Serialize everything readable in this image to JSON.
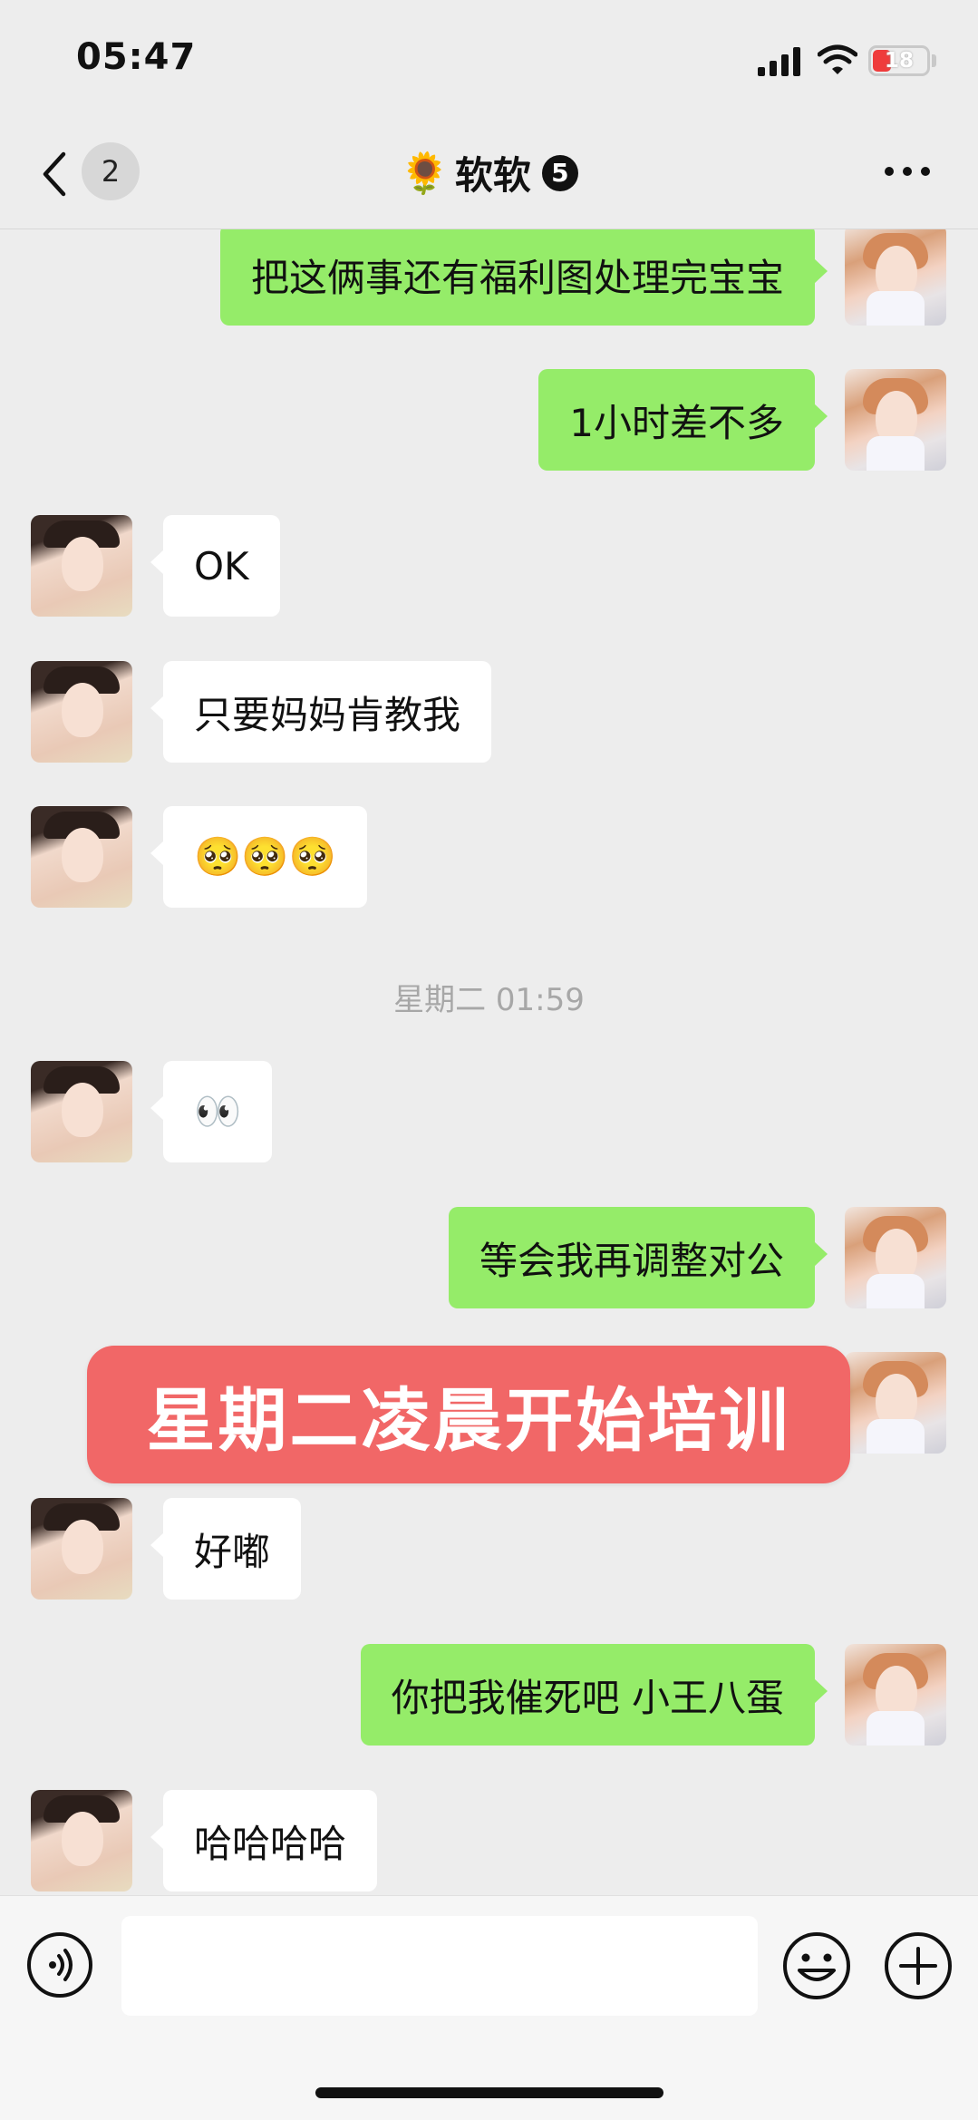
{
  "status_bar": {
    "time": "05:47",
    "battery": "18",
    "battery_color": "#ef3b3b"
  },
  "header": {
    "back_icon": "chevron-left-icon",
    "unread_count": "2",
    "title_emoji": "🌻",
    "title": "软软",
    "title_badge": "5",
    "more_icon": "ellipsis-icon"
  },
  "messages": [
    {
      "side": "out",
      "text": "把这俩事还有福利图处理完宝宝"
    },
    {
      "side": "out",
      "text": "1小时差不多"
    },
    {
      "side": "in",
      "text": "OK"
    },
    {
      "side": "in",
      "text": "只要妈妈肯教我"
    },
    {
      "side": "in",
      "text": "🥺🥺🥺"
    },
    {
      "type": "time",
      "text": "星期二 01:59"
    },
    {
      "side": "in",
      "text": "👀"
    },
    {
      "side": "out",
      "text": "等会我再调整对公"
    },
    {
      "side": "out",
      "text": ""
    },
    {
      "side": "in",
      "text": "好嘟"
    },
    {
      "side": "out",
      "text": "你把我催死吧  小王八蛋"
    },
    {
      "side": "in",
      "text": "哈哈哈哈"
    }
  ],
  "overlay_banner": "星期二凌晨开始培训",
  "colors": {
    "outgoing_bubble": "#95ec69",
    "incoming_bubble": "#ffffff",
    "banner": "#f16767"
  },
  "input_bar": {
    "voice_icon": "voice-icon",
    "input_value": "",
    "emoji_icon": "smiley-icon",
    "add_icon": "plus-circle-icon"
  }
}
